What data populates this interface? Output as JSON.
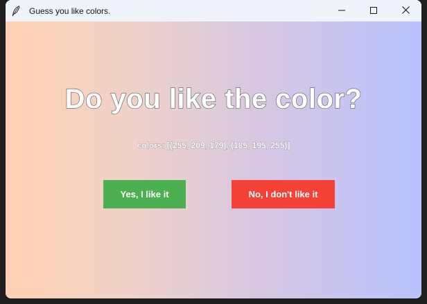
{
  "window": {
    "title": "Guess you like colors.",
    "icon": "feather-icon"
  },
  "controls": {
    "minimize": "minimize-icon",
    "maximize": "maximize-icon",
    "close": "close-icon"
  },
  "main": {
    "question": "Do you like the color?",
    "colors_text": "colors: [(255, 209, 179), (185, 195, 255)]",
    "gradient_colors": [
      "#ffd1b3",
      "#b9c3ff"
    ]
  },
  "buttons": {
    "yes_label": "Yes, I like it",
    "yes_color": "#4caf50",
    "no_label": "No, I don't like it",
    "no_color": "#f44336"
  }
}
